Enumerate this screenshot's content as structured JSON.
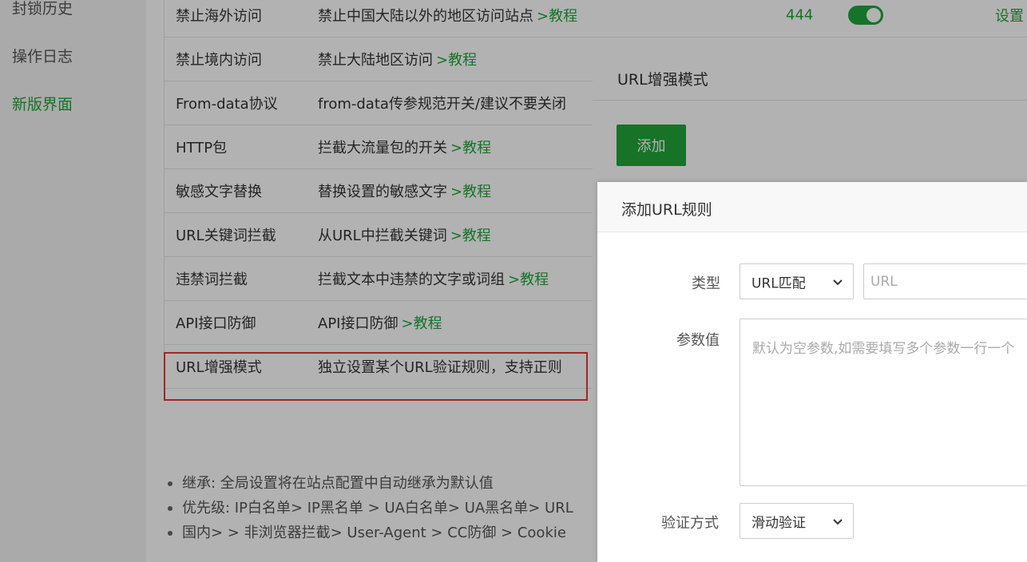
{
  "sidebar": {
    "items": [
      {
        "label": "封锁历史"
      },
      {
        "label": "操作日志"
      },
      {
        "label": "新版界面",
        "active": true
      }
    ]
  },
  "rules": [
    {
      "name": "禁止海外访问",
      "desc": "禁止中国大陆以外的地区访问站点",
      "link": ">教程",
      "count": "444",
      "toggle_on": true,
      "set": "设置"
    },
    {
      "name": "禁止境内访问",
      "desc": "禁止大陆地区访问",
      "link": ">教程"
    },
    {
      "name": "From-data协议",
      "desc": "from-data传参规范开关/建议不要关闭",
      "link": ""
    },
    {
      "name": "HTTP包",
      "desc": "拦截大流量包的开关",
      "link": ">教程"
    },
    {
      "name": "敏感文字替换",
      "desc": "替换设置的敏感文字",
      "link": ">教程"
    },
    {
      "name": "URL关键词拦截",
      "desc": "从URL中拦截关键词",
      "link": ">教程"
    },
    {
      "name": "违禁词拦截",
      "desc": "拦截文本中违禁的文字或词组",
      "link": ">教程"
    },
    {
      "name": "API接口防御",
      "desc": "API接口防御",
      "link": ">教程"
    },
    {
      "name": "URL增强模式",
      "desc": "独立设置某个URL验证规则，支持正则",
      "link": ""
    }
  ],
  "notes": [
    "继承: 全局设置将在站点配置中自动继承为默认值",
    "优先级: IP白名单> IP黑名单 > UA白名单> UA黑名单> URL",
    "国内> > 非浏览器拦截> User-Agent > CC防御 > Cookie"
  ],
  "modal_outer": {
    "title": "URL增强模式",
    "add_label": "添加"
  },
  "modal_inner": {
    "title": "添加URL规则",
    "type_label": "类型",
    "type_value": "URL匹配",
    "url_placeholder": "URL",
    "param_label": "参数值",
    "param_placeholder": "默认为空参数,如需要填写多个参数一行一个",
    "verify_label": "验证方式",
    "verify_value": "滑动验证"
  },
  "colors": {
    "accent": "#20a53a",
    "highlight_border": "#e53935"
  },
  "icons": {
    "select_arrow": "chevron-down-icon"
  }
}
